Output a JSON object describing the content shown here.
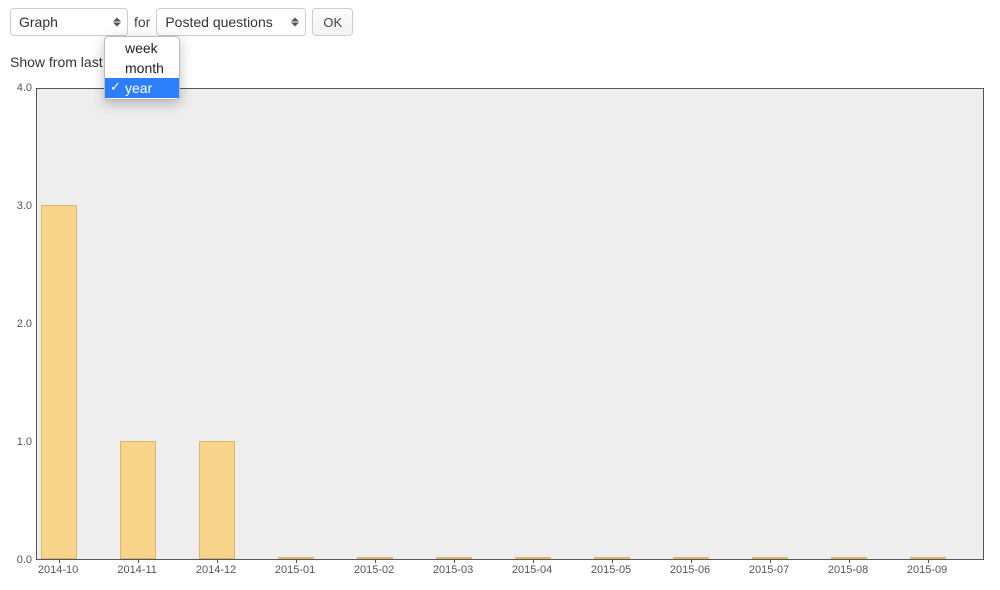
{
  "controls": {
    "view_select": {
      "value": "Graph"
    },
    "for_label": "for",
    "metric_select": {
      "value": "Posted questions"
    },
    "ok_label": "OK"
  },
  "range": {
    "prefix": "Show from last",
    "options": [
      "week",
      "month",
      "year"
    ],
    "selected": "year"
  },
  "chart_data": {
    "type": "bar",
    "categories": [
      "2014-10",
      "2014-11",
      "2014-12",
      "2015-01",
      "2015-02",
      "2015-03",
      "2015-04",
      "2015-05",
      "2015-06",
      "2015-07",
      "2015-08",
      "2015-09"
    ],
    "values": [
      3,
      1,
      1,
      0,
      0,
      0,
      0,
      0,
      0,
      0,
      0,
      0
    ],
    "title": "",
    "xlabel": "",
    "ylabel": "",
    "ylim": [
      0,
      4
    ],
    "yticks": [
      0.0,
      1.0,
      2.0,
      3.0,
      4.0
    ],
    "bar_color": "#f8d58b"
  }
}
